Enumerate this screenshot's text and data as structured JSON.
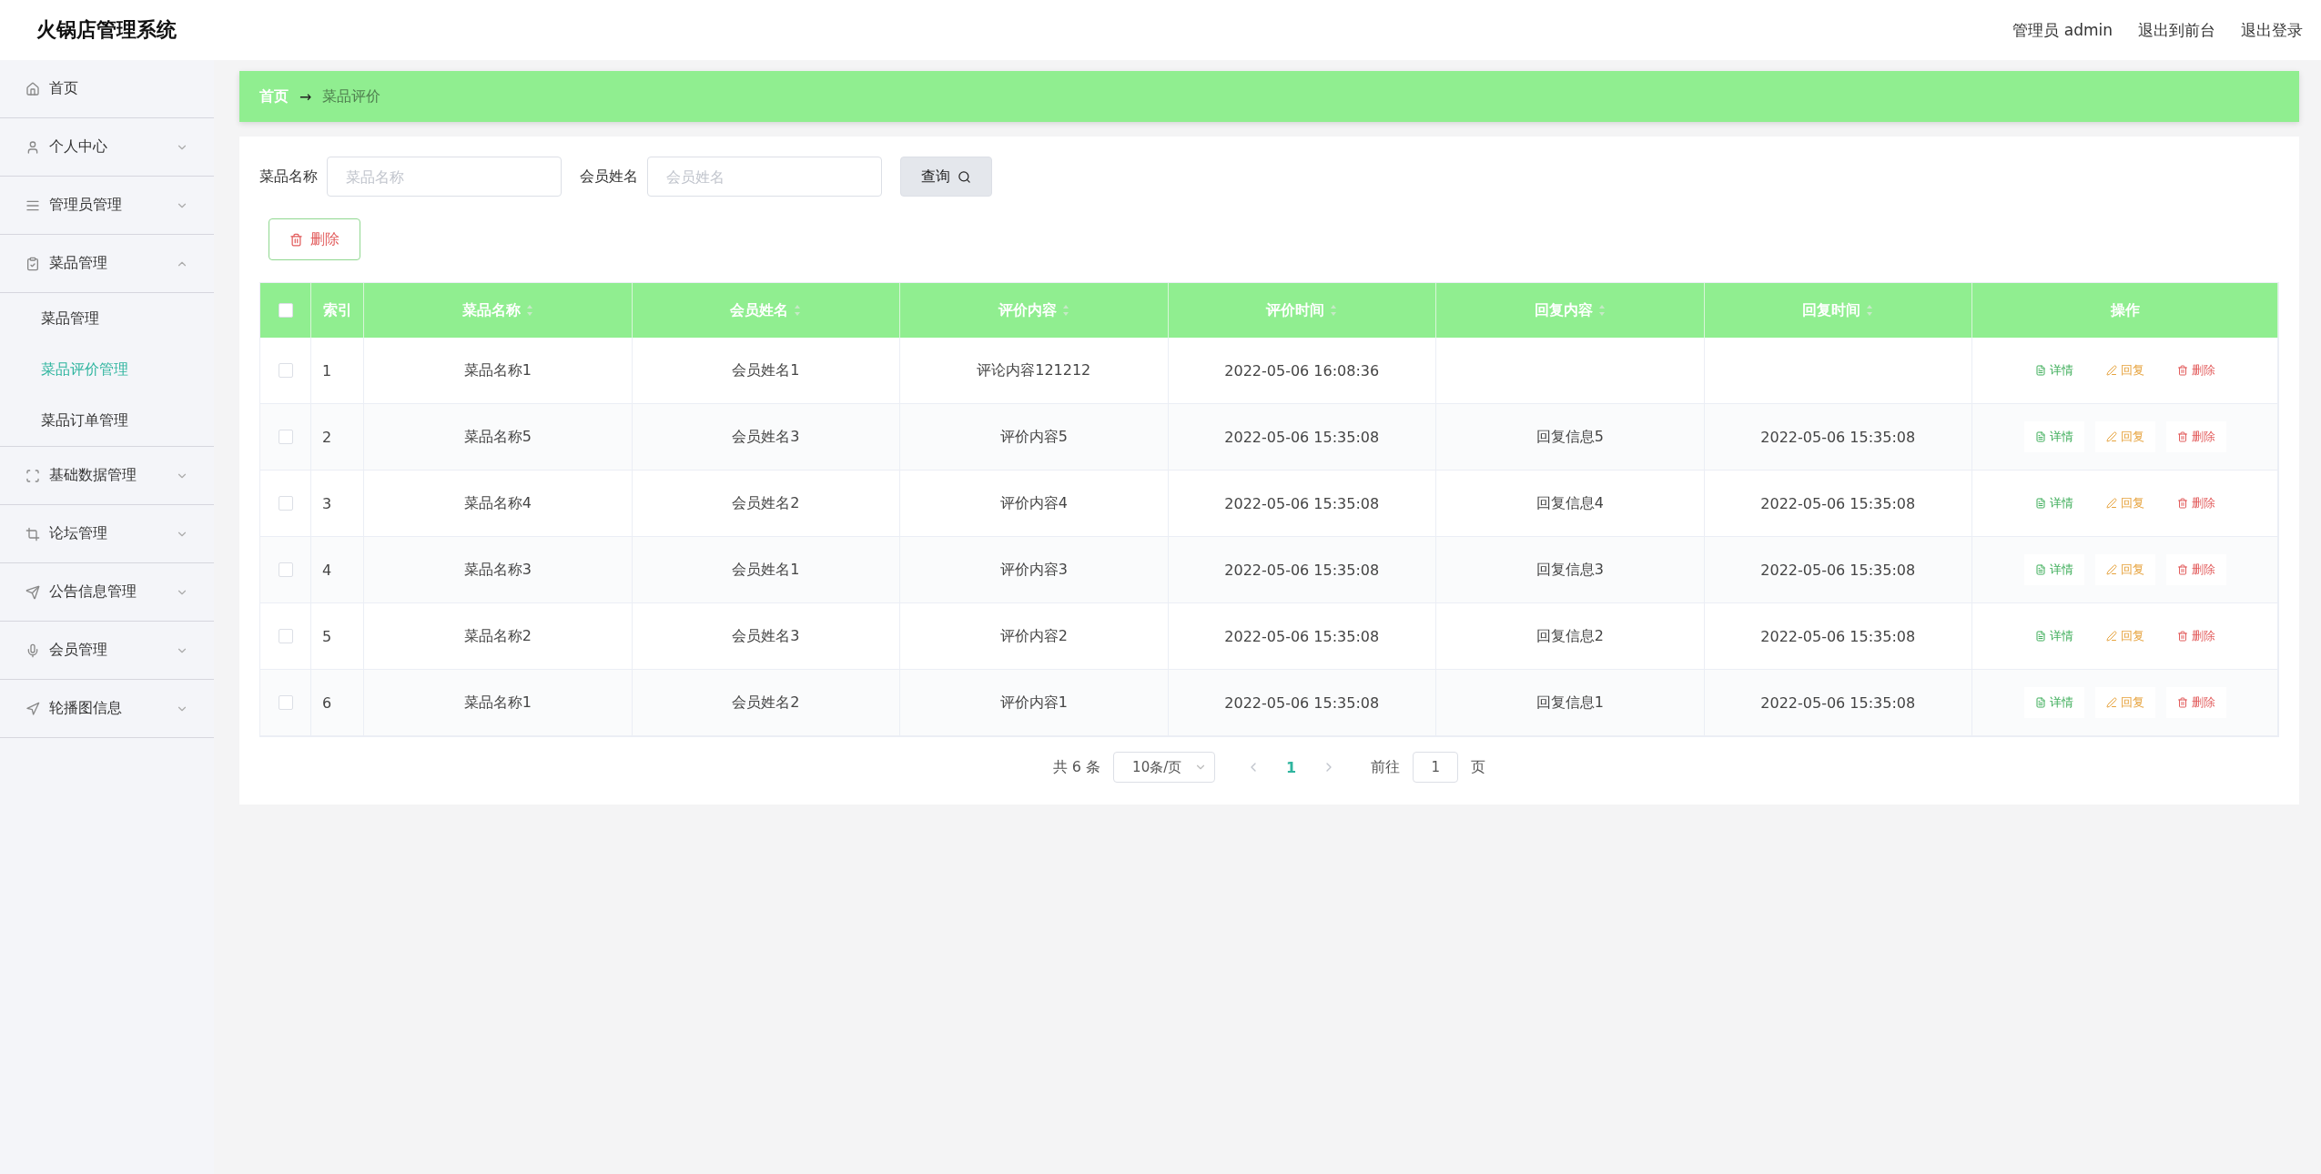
{
  "header": {
    "title": "火锅店管理系统",
    "links": [
      "管理员 admin",
      "退出到前台",
      "退出登录"
    ]
  },
  "sidebar": {
    "items": [
      {
        "label": "首页"
      },
      {
        "label": "个人中心",
        "expanded": false
      },
      {
        "label": "管理员管理",
        "expanded": false
      },
      {
        "label": "菜品管理",
        "expanded": true,
        "children": [
          {
            "label": "菜品管理",
            "selected": false
          },
          {
            "label": "菜品评价管理",
            "selected": true
          },
          {
            "label": "菜品订单管理",
            "selected": false
          }
        ]
      },
      {
        "label": "基础数据管理",
        "expanded": false
      },
      {
        "label": "论坛管理",
        "expanded": false
      },
      {
        "label": "公告信息管理",
        "expanded": false
      },
      {
        "label": "会员管理",
        "expanded": false
      },
      {
        "label": "轮播图信息",
        "expanded": false
      }
    ]
  },
  "breadcrumb": {
    "home": "首页",
    "separator": "→",
    "current": "菜品评价"
  },
  "search": {
    "fields": [
      {
        "label": "菜品名称",
        "placeholder": "菜品名称"
      },
      {
        "label": "会员姓名",
        "placeholder": "会员姓名"
      }
    ],
    "button": "查询"
  },
  "toolbar": {
    "delete_button": "删除"
  },
  "table": {
    "select_all_checked": false,
    "columns": [
      {
        "label": "索引",
        "sortable": false
      },
      {
        "label": "菜品名称",
        "sortable": true
      },
      {
        "label": "会员姓名",
        "sortable": true
      },
      {
        "label": "评价内容",
        "sortable": true
      },
      {
        "label": "评价时间",
        "sortable": true
      },
      {
        "label": "回复内容",
        "sortable": true
      },
      {
        "label": "回复时间",
        "sortable": true
      },
      {
        "label": "操作",
        "sortable": false
      }
    ],
    "rows": [
      {
        "checked": false,
        "cells": [
          "1",
          "菜品名称1",
          "会员姓名1",
          "评论内容121212",
          "2022-05-06 16:08:36",
          "",
          ""
        ],
        "actions": [
          {
            "kind": "detail",
            "label": "详情"
          },
          {
            "kind": "reply",
            "label": "回复"
          },
          {
            "kind": "delete",
            "label": "删除"
          }
        ]
      },
      {
        "checked": false,
        "cells": [
          "2",
          "菜品名称5",
          "会员姓名3",
          "评价内容5",
          "2022-05-06 15:35:08",
          "回复信息5",
          "2022-05-06 15:35:08"
        ],
        "actions": [
          {
            "kind": "detail",
            "label": "详情"
          },
          {
            "kind": "reply",
            "label": "回复"
          },
          {
            "kind": "delete",
            "label": "删除"
          }
        ]
      },
      {
        "checked": false,
        "cells": [
          "3",
          "菜品名称4",
          "会员姓名2",
          "评价内容4",
          "2022-05-06 15:35:08",
          "回复信息4",
          "2022-05-06 15:35:08"
        ],
        "actions": [
          {
            "kind": "detail",
            "label": "详情"
          },
          {
            "kind": "reply",
            "label": "回复"
          },
          {
            "kind": "delete",
            "label": "删除"
          }
        ]
      },
      {
        "checked": false,
        "cells": [
          "4",
          "菜品名称3",
          "会员姓名1",
          "评价内容3",
          "2022-05-06 15:35:08",
          "回复信息3",
          "2022-05-06 15:35:08"
        ],
        "actions": [
          {
            "kind": "detail",
            "label": "详情"
          },
          {
            "kind": "reply",
            "label": "回复"
          },
          {
            "kind": "delete",
            "label": "删除"
          }
        ]
      },
      {
        "checked": false,
        "cells": [
          "5",
          "菜品名称2",
          "会员姓名3",
          "评价内容2",
          "2022-05-06 15:35:08",
          "回复信息2",
          "2022-05-06 15:35:08"
        ],
        "actions": [
          {
            "kind": "detail",
            "label": "详情"
          },
          {
            "kind": "reply",
            "label": "回复"
          },
          {
            "kind": "delete",
            "label": "删除"
          }
        ]
      },
      {
        "checked": false,
        "cells": [
          "6",
          "菜品名称1",
          "会员姓名2",
          "评价内容1",
          "2022-05-06 15:35:08",
          "回复信息1",
          "2022-05-06 15:35:08"
        ],
        "actions": [
          {
            "kind": "detail",
            "label": "详情"
          },
          {
            "kind": "reply",
            "label": "回复"
          },
          {
            "kind": "delete",
            "label": "删除"
          }
        ]
      }
    ]
  },
  "pagination": {
    "total": "共 6 条",
    "page_size": "10条/页",
    "pages": [
      {
        "label": "1",
        "selected": true
      }
    ],
    "goto_label": "前往",
    "goto_value": "1",
    "goto_suffix": "页"
  }
}
